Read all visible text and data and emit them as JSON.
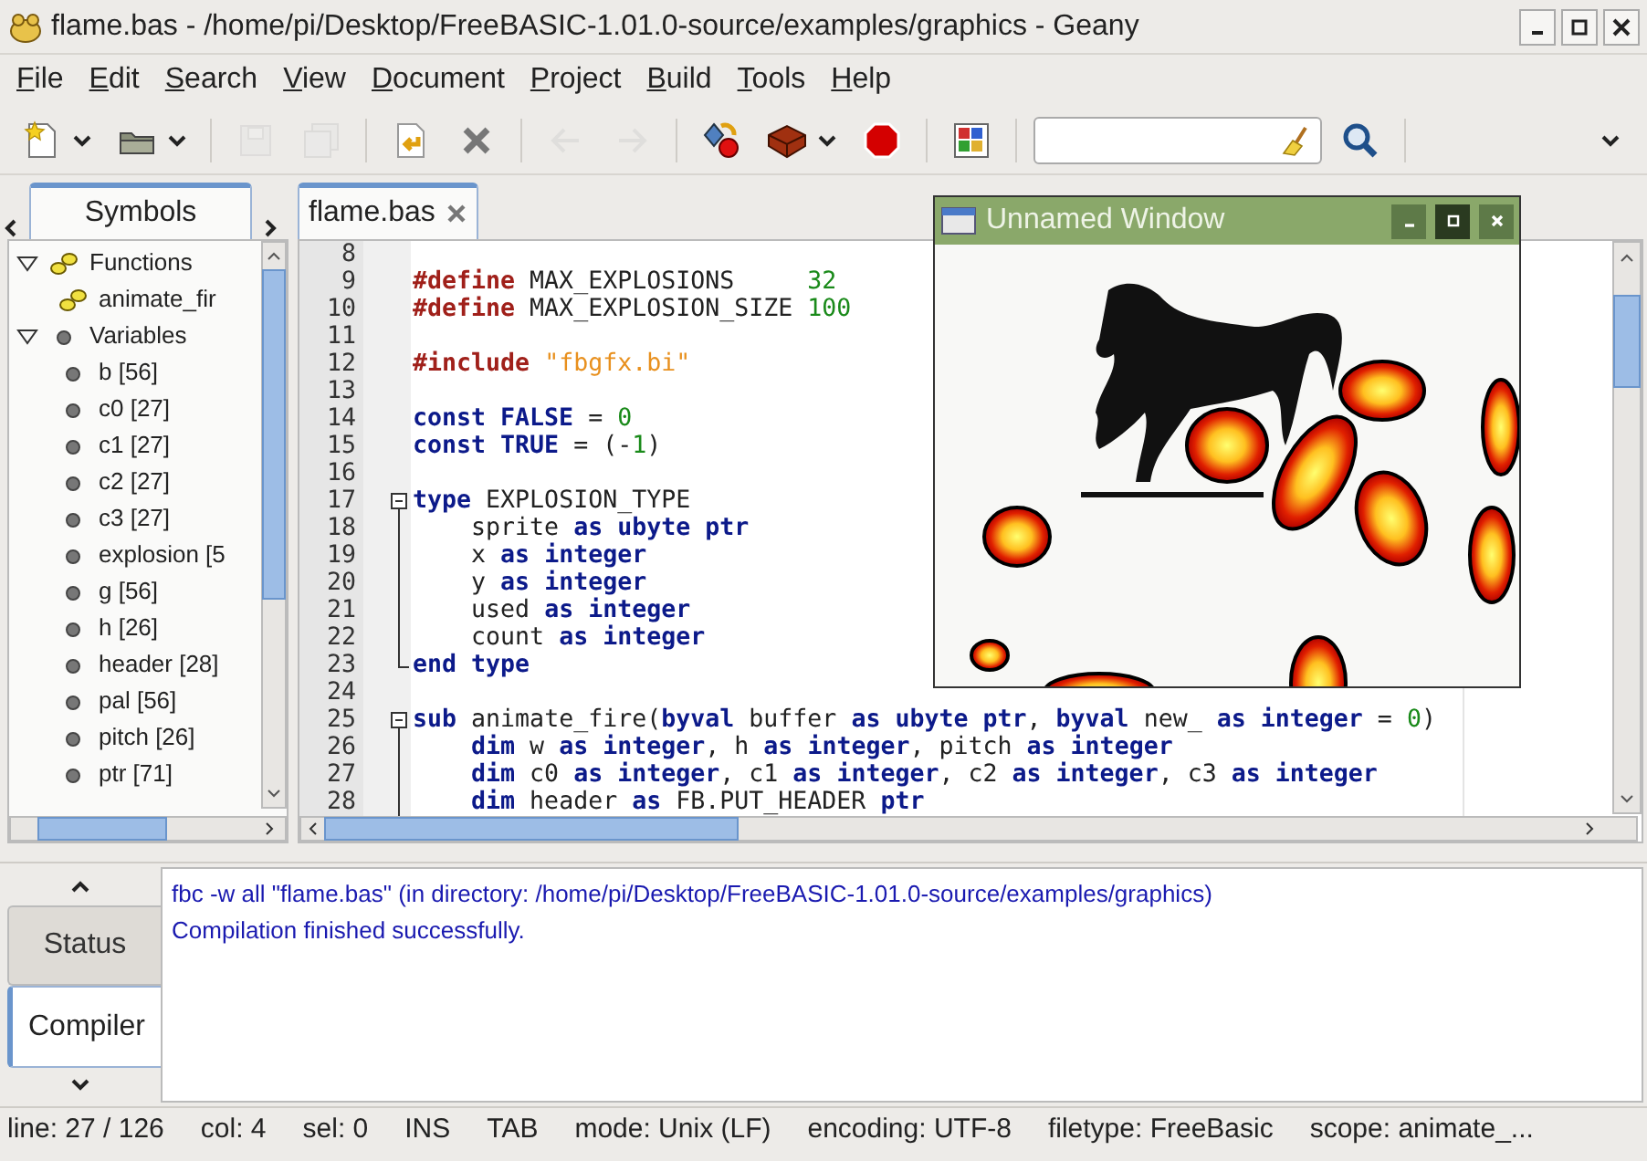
{
  "window": {
    "title": "flame.bas - /home/pi/Desktop/FreeBASIC-1.01.0-source/examples/graphics - Geany"
  },
  "menu": [
    "File",
    "Edit",
    "Search",
    "View",
    "Document",
    "Project",
    "Build",
    "Tools",
    "Help"
  ],
  "toolbar": [
    {
      "kind": "button",
      "disabled": false,
      "dropdown": true
    },
    {
      "kind": "button",
      "disabled": false,
      "dropdown": true
    },
    {
      "kind": "separator"
    },
    {
      "kind": "button",
      "disabled": true,
      "dropdown": false
    },
    {
      "kind": "button",
      "disabled": true,
      "dropdown": false
    },
    {
      "kind": "separator"
    },
    {
      "kind": "button",
      "disabled": false,
      "dropdown": false
    },
    {
      "kind": "button",
      "disabled": false,
      "dropdown": false
    },
    {
      "kind": "separator"
    },
    {
      "kind": "button",
      "disabled": true,
      "dropdown": false
    },
    {
      "kind": "button",
      "disabled": true,
      "dropdown": false
    },
    {
      "kind": "separator"
    },
    {
      "kind": "button",
      "disabled": false,
      "dropdown": false
    },
    {
      "kind": "button",
      "disabled": false,
      "dropdown": true
    },
    {
      "kind": "button",
      "disabled": false,
      "dropdown": false
    },
    {
      "kind": "separator"
    },
    {
      "kind": "button",
      "disabled": false,
      "dropdown": false
    },
    {
      "kind": "separator"
    },
    {
      "kind": "field"
    },
    {
      "kind": "button",
      "disabled": false,
      "dropdown": false
    },
    {
      "kind": "separator"
    }
  ],
  "sidebar": {
    "tabs": [
      {
        "label": "Symbols",
        "selected": true
      }
    ],
    "tree": [
      {
        "label": "Functions",
        "kind": "function",
        "expanded": true,
        "children": [
          {
            "label": "animate_fir",
            "kind": "function"
          }
        ]
      },
      {
        "label": "Variables",
        "kind": "variable",
        "expanded": true,
        "children": [
          {
            "label": "b [56]",
            "kind": "variable"
          },
          {
            "label": "c0 [27]",
            "kind": "variable"
          },
          {
            "label": "c1 [27]",
            "kind": "variable"
          },
          {
            "label": "c2 [27]",
            "kind": "variable"
          },
          {
            "label": "c3 [27]",
            "kind": "variable"
          },
          {
            "label": "explosion [5",
            "kind": "variable"
          },
          {
            "label": "g [56]",
            "kind": "variable"
          },
          {
            "label": "h [26]",
            "kind": "variable"
          },
          {
            "label": "header [28]",
            "kind": "variable"
          },
          {
            "label": "pal [56]",
            "kind": "variable"
          },
          {
            "label": "pitch [26]",
            "kind": "variable"
          },
          {
            "label": "ptr [71]",
            "kind": "variable"
          }
        ]
      }
    ]
  },
  "editor": {
    "tabs": [
      {
        "label": "flame.bas",
        "selected": true
      }
    ],
    "lines": [
      {
        "n": "8"
      },
      {
        "n": "9",
        "tokens": [
          {
            "kind": "preprocessor",
            "t": "#define "
          },
          {
            "kind": "plain",
            "t": "MAX_EXPLOSIONS     "
          },
          {
            "kind": "number",
            "t": "32"
          }
        ]
      },
      {
        "n": "10",
        "tokens": [
          {
            "kind": "preprocessor",
            "t": "#define "
          },
          {
            "kind": "plain",
            "t": "MAX_EXPLOSION_SIZE "
          },
          {
            "kind": "number",
            "t": "100"
          }
        ]
      },
      {
        "n": "11"
      },
      {
        "n": "12",
        "tokens": [
          {
            "kind": "preprocessor",
            "t": "#include "
          },
          {
            "kind": "string",
            "t": "\"fbgfx.bi\""
          }
        ]
      },
      {
        "n": "13"
      },
      {
        "n": "14",
        "tokens": [
          {
            "kind": "keyword",
            "t": "const FALSE"
          },
          {
            "kind": "plain",
            "t": " = "
          },
          {
            "kind": "number",
            "t": "0"
          }
        ]
      },
      {
        "n": "15",
        "tokens": [
          {
            "kind": "keyword",
            "t": "const TRUE"
          },
          {
            "kind": "plain",
            "t": " = (-"
          },
          {
            "kind": "number",
            "t": "1"
          },
          {
            "kind": "plain",
            "t": ")"
          }
        ]
      },
      {
        "n": "16"
      },
      {
        "n": "17",
        "kind": "fold-start",
        "tokens": [
          {
            "kind": "keyword",
            "t": "type"
          },
          {
            "kind": "plain",
            "t": " EXPLOSION_TYPE"
          }
        ]
      },
      {
        "n": "18",
        "kind": "fold-body",
        "tokens": [
          {
            "kind": "plain",
            "t": "    sprite "
          },
          {
            "kind": "keyword",
            "t": "as ubyte ptr"
          }
        ]
      },
      {
        "n": "19",
        "kind": "fold-body",
        "tokens": [
          {
            "kind": "plain",
            "t": "    x "
          },
          {
            "kind": "keyword",
            "t": "as integer"
          }
        ]
      },
      {
        "n": "20",
        "kind": "fold-body",
        "tokens": [
          {
            "kind": "plain",
            "t": "    y "
          },
          {
            "kind": "keyword",
            "t": "as integer"
          }
        ]
      },
      {
        "n": "21",
        "kind": "fold-body",
        "tokens": [
          {
            "kind": "plain",
            "t": "    used "
          },
          {
            "kind": "keyword",
            "t": "as integer"
          }
        ]
      },
      {
        "n": "22",
        "kind": "fold-body",
        "tokens": [
          {
            "kind": "plain",
            "t": "    count "
          },
          {
            "kind": "keyword",
            "t": "as integer"
          }
        ]
      },
      {
        "n": "23",
        "kind": "fold-end",
        "tokens": [
          {
            "kind": "keyword",
            "t": "end type"
          }
        ]
      },
      {
        "n": "24"
      },
      {
        "n": "25",
        "kind": "fold-start",
        "tokens": [
          {
            "kind": "keyword",
            "t": "sub"
          },
          {
            "kind": "plain",
            "t": " animate_fire("
          },
          {
            "kind": "keyword",
            "t": "byval"
          },
          {
            "kind": "plain",
            "t": " buffer "
          },
          {
            "kind": "keyword",
            "t": "as ubyte ptr"
          },
          {
            "kind": "plain",
            "t": ", "
          },
          {
            "kind": "keyword",
            "t": "byval"
          },
          {
            "kind": "plain",
            "t": " new_ "
          },
          {
            "kind": "keyword",
            "t": "as integer"
          },
          {
            "kind": "plain",
            "t": " = "
          },
          {
            "kind": "number",
            "t": "0"
          },
          {
            "kind": "plain",
            "t": ")"
          }
        ]
      },
      {
        "n": "26",
        "kind": "fold-body",
        "tokens": [
          {
            "kind": "keyword",
            "t": "    dim"
          },
          {
            "kind": "plain",
            "t": " w "
          },
          {
            "kind": "keyword",
            "t": "as integer"
          },
          {
            "kind": "plain",
            "t": ", h "
          },
          {
            "kind": "keyword",
            "t": "as integer"
          },
          {
            "kind": "plain",
            "t": ", pitch "
          },
          {
            "kind": "keyword",
            "t": "as integer"
          }
        ]
      },
      {
        "n": "27",
        "kind": "fold-body",
        "tokens": [
          {
            "kind": "keyword",
            "t": "    dim"
          },
          {
            "kind": "plain",
            "t": " c0 "
          },
          {
            "kind": "keyword",
            "t": "as integer"
          },
          {
            "kind": "plain",
            "t": ", c1 "
          },
          {
            "kind": "keyword",
            "t": "as integer"
          },
          {
            "kind": "plain",
            "t": ", c2 "
          },
          {
            "kind": "keyword",
            "t": "as integer"
          },
          {
            "kind": "plain",
            "t": ", c3 "
          },
          {
            "kind": "keyword",
            "t": "as integer"
          }
        ]
      },
      {
        "n": "28",
        "kind": "fold-body",
        "tokens": [
          {
            "kind": "keyword",
            "t": "    dim"
          },
          {
            "kind": "plain",
            "t": " header "
          },
          {
            "kind": "keyword",
            "t": "as"
          },
          {
            "kind": "plain",
            "t": " FB.PUT_HEADER "
          },
          {
            "kind": "keyword",
            "t": "ptr"
          }
        ]
      }
    ]
  },
  "output_window": {
    "title": "Unnamed Window"
  },
  "messages": {
    "tabs": [
      {
        "label": "Status",
        "selected": false
      },
      {
        "label": "Compiler",
        "selected": true
      }
    ],
    "lines": [
      "fbc -w all \"flame.bas\" (in directory: /home/pi/Desktop/FreeBASIC-1.01.0-source/examples/graphics)",
      "Compilation finished successfully."
    ]
  },
  "status_bar": [
    "line: 27 / 126",
    "col: 4",
    "sel: 0",
    "INS",
    "TAB",
    "mode: Unix (LF)",
    "encoding: UTF-8",
    "filetype: FreeBasic",
    "scope: animate_..."
  ]
}
